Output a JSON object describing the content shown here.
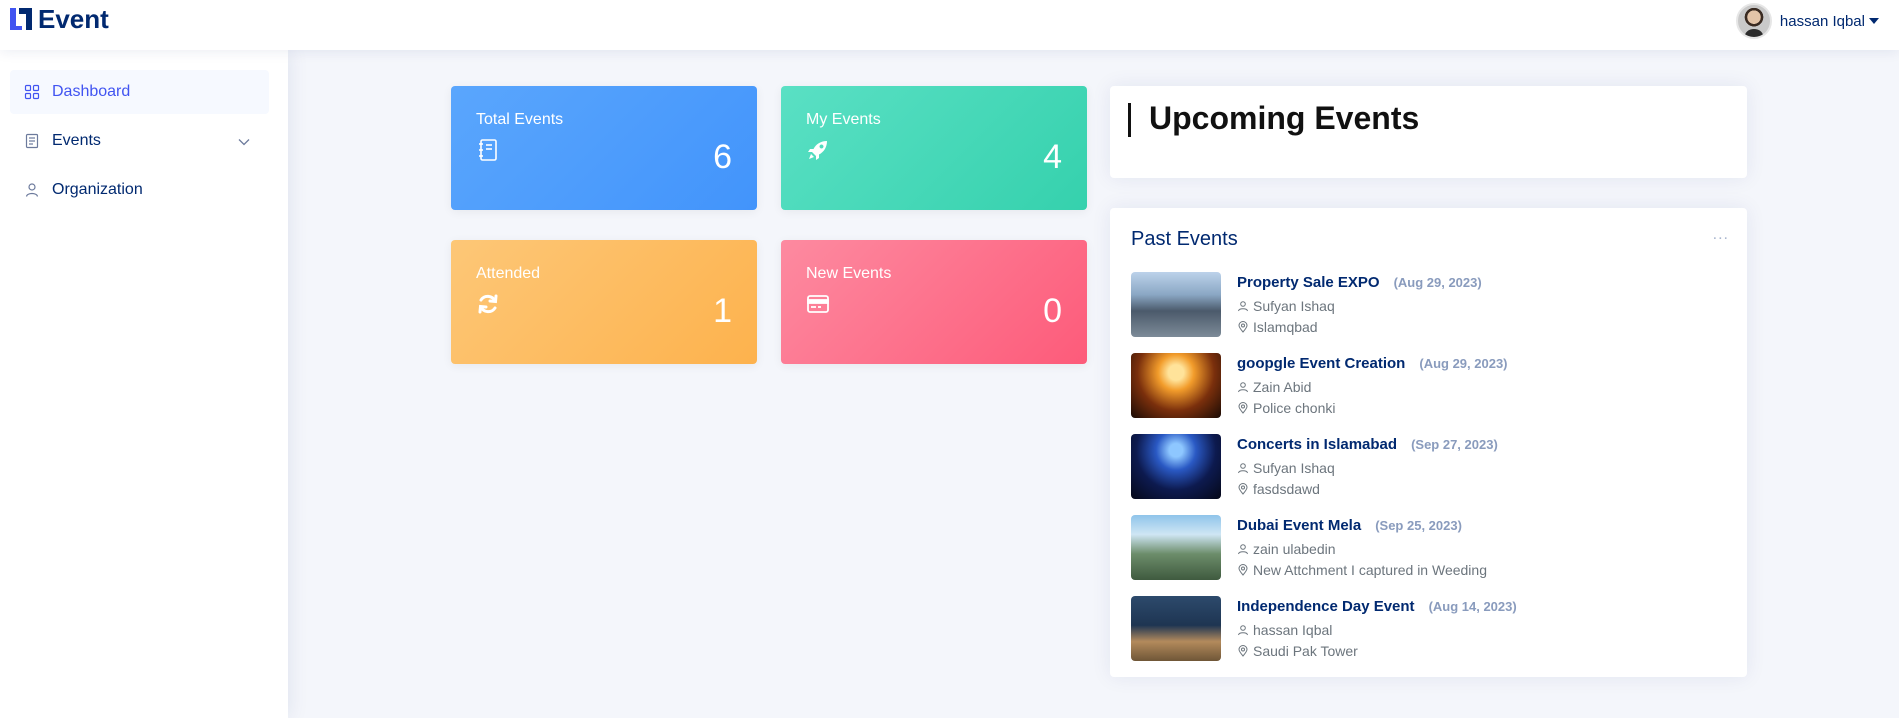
{
  "header": {
    "logo_text": "Event",
    "user_name": "hassan Iqbal"
  },
  "sidebar": {
    "items": [
      {
        "label": "Dashboard",
        "icon": "grid-icon",
        "active": true
      },
      {
        "label": "Events",
        "icon": "journal-icon",
        "expandable": true
      },
      {
        "label": "Organization",
        "icon": "person-icon"
      }
    ]
  },
  "stats": [
    {
      "title": "Total Events",
      "value": "6",
      "icon": "journal-icon",
      "color": "#4294fb"
    },
    {
      "title": "My Events",
      "value": "4",
      "icon": "rocket-icon",
      "color": "#35d1ad"
    },
    {
      "title": "Attended",
      "value": "1",
      "icon": "refresh-icon",
      "color": "#fdb24d"
    },
    {
      "title": "New Events",
      "value": "0",
      "icon": "credit-card-icon",
      "color": "#fd5b7a"
    }
  ],
  "upcoming": {
    "title": "Upcoming Events"
  },
  "past": {
    "title": "Past Events",
    "menu": "...",
    "events": [
      {
        "title": "Property Sale EXPO",
        "date": "(Aug 29, 2023)",
        "organizer": "Sufyan Ishaq",
        "location": "Islamqbad"
      },
      {
        "title": "goopgle Event Creation",
        "date": "(Aug 29, 2023)",
        "organizer": "Zain Abid",
        "location": "Police chonki"
      },
      {
        "title": "Concerts in Islamabad",
        "date": "(Sep 27, 2023)",
        "organizer": "Sufyan Ishaq",
        "location": "fasdsdawd"
      },
      {
        "title": "Dubai Event Mela",
        "date": "(Sep 25, 2023)",
        "organizer": "zain ulabedin",
        "location": "New Attchment I captured in Weeding"
      },
      {
        "title": "Independence Day Event",
        "date": "(Aug 14, 2023)",
        "organizer": "hassan Iqbal",
        "location": "Saudi Pak Tower"
      }
    ]
  }
}
